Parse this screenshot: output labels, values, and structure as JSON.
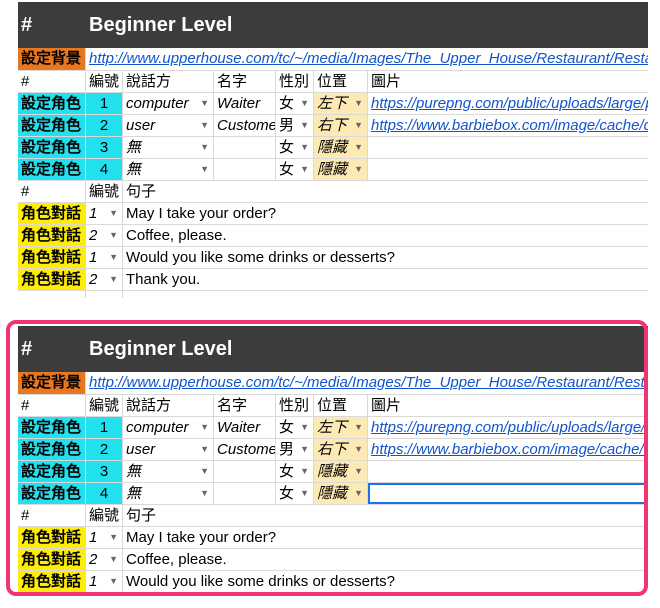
{
  "sheet": {
    "header": {
      "hash": "#",
      "title": "Beginner Level"
    },
    "background": {
      "label": "設定背景",
      "url": "http://www.upperhouse.com/tc/~/media/Images/The_Upper_House/Restaurant/Restaurant"
    },
    "role_columns": {
      "hash": "#",
      "number": "編號",
      "speaker": "說話方",
      "name": "名字",
      "gender": "性別",
      "position": "位置",
      "image": "圖片"
    },
    "roles": [
      {
        "label": "設定角色",
        "number": "1",
        "speaker": "computer",
        "name": "Waiter",
        "gender": "女",
        "position": "左下",
        "image": "https://purepng.com/public/uploads/large/purepng"
      },
      {
        "label": "設定角色",
        "number": "2",
        "speaker": "user",
        "name": "Customer",
        "gender": "男",
        "position": "右下",
        "image": "https://www.barbiebox.com/image/cache/data"
      },
      {
        "label": "設定角色",
        "number": "3",
        "speaker": "無",
        "name": "",
        "gender": "女",
        "position": "隱藏",
        "image": ""
      },
      {
        "label": "設定角色",
        "number": "4",
        "speaker": "無",
        "name": "",
        "gender": "女",
        "position": "隱藏",
        "image": ""
      }
    ],
    "dialog_columns": {
      "hash": "#",
      "number": "編號",
      "sentence": "句子"
    },
    "dialogs_top": [
      {
        "label": "角色對話",
        "number": "1",
        "sentence": "May I take your order?"
      },
      {
        "label": "角色對話",
        "number": "2",
        "sentence": "Coffee, please."
      },
      {
        "label": "角色對話",
        "number": "1",
        "sentence": "Would you like some drinks or desserts?"
      },
      {
        "label": "角色對話",
        "number": "2",
        "sentence": "Thank you."
      }
    ],
    "dialogs_bottom": [
      {
        "label": "角色對話",
        "number": "1",
        "sentence": "May I take your order?"
      },
      {
        "label": "角色對話",
        "number": "2",
        "sentence": "Coffee, please."
      },
      {
        "label": "角色對話",
        "number": "1",
        "sentence": "Would you like some drinks or desserts?"
      }
    ]
  },
  "colors": {
    "highlight_frame": "#f0366f",
    "header_bg": "#3c3c3c",
    "orange": "#e87722",
    "cyan": "#22e0ee",
    "yellow": "#ffee00",
    "position_bg": "#fde9b3"
  }
}
